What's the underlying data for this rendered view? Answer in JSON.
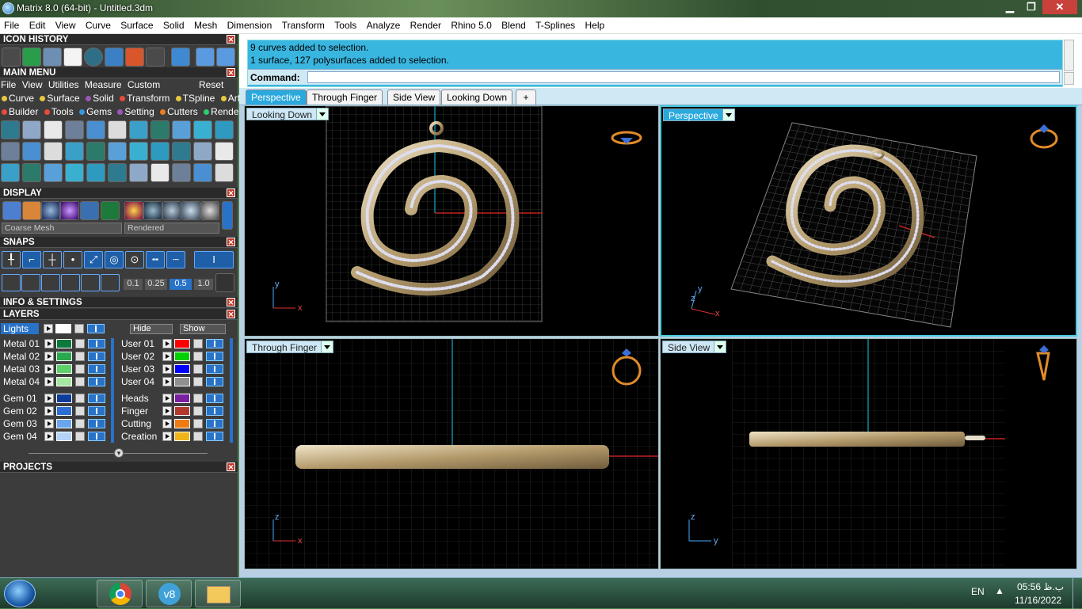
{
  "window": {
    "title": "Matrix 8.0 (64-bit) - Untitled.3dm",
    "minimize": "▁",
    "restore": "❐",
    "close": "✕"
  },
  "menu": [
    "File",
    "Edit",
    "View",
    "Curve",
    "Surface",
    "Solid",
    "Mesh",
    "Dimension",
    "Transform",
    "Tools",
    "Analyze",
    "Render",
    "Rhino 5.0",
    "Blend",
    "T-Splines",
    "Help"
  ],
  "panel": {
    "icon_history": "ICON HISTORY",
    "main_menu": "MAIN MENU",
    "main_menu_items": [
      "File",
      "View",
      "Utilities",
      "Measure",
      "Custom"
    ],
    "reset": "Reset",
    "row1": [
      {
        "label": "Curve",
        "color": "#e8c840"
      },
      {
        "label": "Surface",
        "color": "#e8c840"
      },
      {
        "label": "Solid",
        "color": "#9b59b6"
      },
      {
        "label": "Transform",
        "color": "#e74c3c"
      },
      {
        "label": "TSpline",
        "color": "#e8c840"
      },
      {
        "label": "Art",
        "color": "#e8c840"
      }
    ],
    "row2": [
      {
        "label": "Builder",
        "color": "#e74c3c"
      },
      {
        "label": "Tools",
        "color": "#e74c3c"
      },
      {
        "label": "Gems",
        "color": "#3498db"
      },
      {
        "label": "Setting",
        "color": "#9b59b6"
      },
      {
        "label": "Cutters",
        "color": "#e67e22"
      },
      {
        "label": "Render",
        "color": "#2ecc71"
      }
    ],
    "display": "DISPLAY",
    "mesh_select": "Coarse Mesh",
    "render_select": "Rendered",
    "snaps": "SNAPS",
    "snap_values": [
      "0.1",
      "0.25",
      "0.5",
      "1.0"
    ],
    "info": "INFO & SETTINGS",
    "layers": "LAYERS",
    "lights": "Lights",
    "hide": "Hide",
    "show": "Show",
    "layer_left": [
      {
        "name": "Metal 01",
        "color": "#0b7a3a"
      },
      {
        "name": "Metal 02",
        "color": "#29a84f"
      },
      {
        "name": "Metal 03",
        "color": "#5ed26a"
      },
      {
        "name": "Metal 04",
        "color": "#a7e8a0"
      },
      {
        "name": "Gem 01",
        "color": "#0d3c9c"
      },
      {
        "name": "Gem 02",
        "color": "#2b6fd6"
      },
      {
        "name": "Gem 03",
        "color": "#6aa6f0"
      },
      {
        "name": "Gem 04",
        "color": "#b4d4f7"
      }
    ],
    "layer_right": [
      {
        "name": "User 01",
        "color": "#ff0000"
      },
      {
        "name": "User 02",
        "color": "#00d000"
      },
      {
        "name": "User 03",
        "color": "#0000ff"
      },
      {
        "name": "User 04",
        "color": "#909090"
      },
      {
        "name": "Heads",
        "color": "#7b1fa2"
      },
      {
        "name": "Finger",
        "color": "#b03a2e"
      },
      {
        "name": "Cutting",
        "color": "#f07b15"
      },
      {
        "name": "Creation",
        "color": "#f0b41a"
      }
    ],
    "projects": "PROJECTS"
  },
  "command": {
    "line1": "9 curves added to selection.",
    "line2": "1 surface, 127 polysurfaces added to selection.",
    "prompt": "Command:"
  },
  "tabs": [
    "Perspective",
    "Through Finger",
    "Side View",
    "Looking Down",
    "+"
  ],
  "viewports": {
    "top_left": "Looking Down",
    "top_right": "Perspective",
    "bottom_left": "Through Finger",
    "bottom_right": "Side View"
  },
  "axes": {
    "x": "x",
    "y": "y",
    "z": "z"
  },
  "taskbar": {
    "lang": "EN",
    "time": "05:56 ب.ظ",
    "date": "11/16/2022"
  },
  "colors": {
    "accent": "#2ba9dd",
    "metal": "#c9b48a"
  }
}
